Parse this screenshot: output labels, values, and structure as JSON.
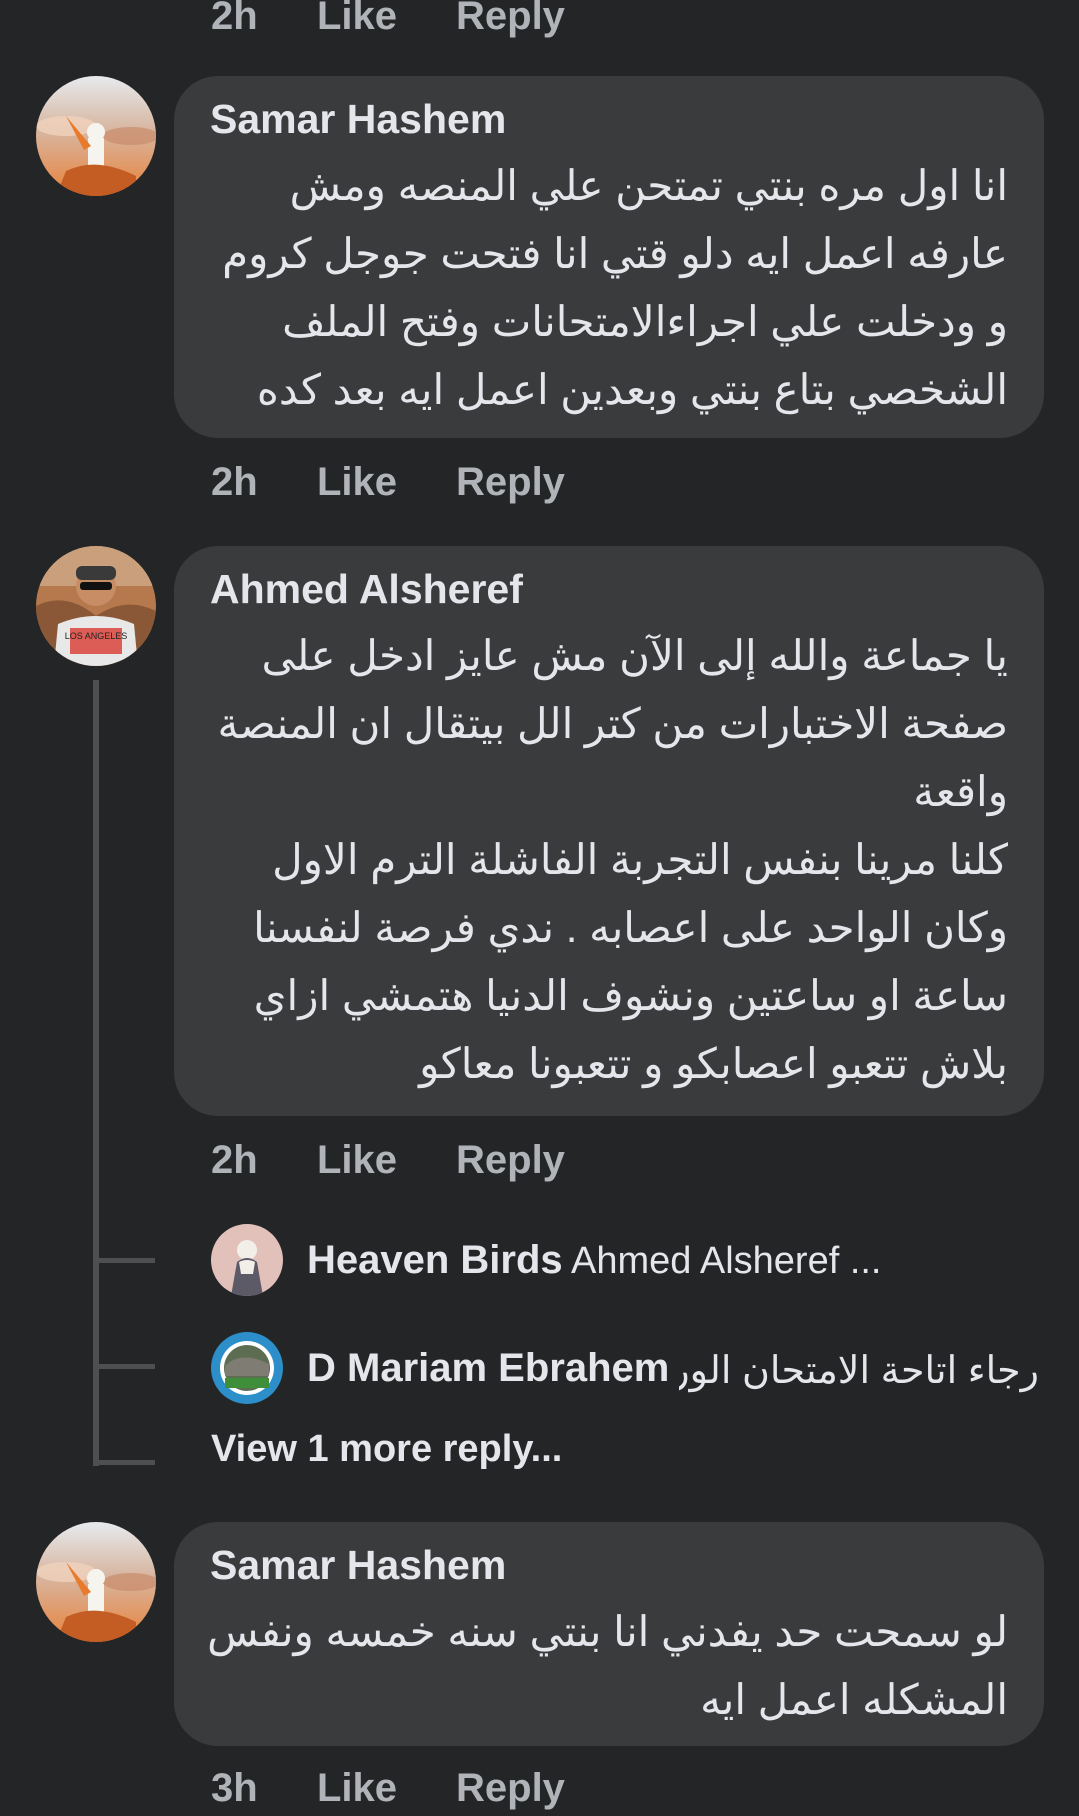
{
  "comments": [
    {
      "author": "",
      "time": "2h",
      "like": "Like",
      "reply": "Reply"
    },
    {
      "author": "Samar Hashem",
      "lines": [
        "انا اول مره بنتي تمتحن علي المنصه ومش",
        "عارفه اعمل ايه دلو قتي انا فتحت جوجل كروم",
        "و ودخلت علي اجراءالامتحانات وفتح الملف",
        "الشخصي بتاع بنتي وبعدين اعمل ايه بعد كده"
      ],
      "time": "2h",
      "like": "Like",
      "reply": "Reply"
    },
    {
      "author": "Ahmed Alsheref",
      "avatar_shirt_text": "LOS ANGELES",
      "lines": [
        "يا جماعة والله إلى الآن مش عايز ادخل على",
        "صفحة الاختبارات من كتر الل بيتقال ان المنصة",
        "واقعة",
        "كلنا مرينا بنفس التجربة الفاشلة الترم الاول",
        "وكان الواحد على اعصابه . ندي فرصة لنفسنا",
        "ساعة او ساعتين ونشوف الدنيا هتمشي ازاي",
        "بلاش تتعبو اعصابكو و تتعبونا معاكو"
      ],
      "time": "2h",
      "like": "Like",
      "reply": "Reply",
      "replies": [
        {
          "name": "Heaven Birds",
          "snippet": "Ahmed Alsheref ..."
        },
        {
          "name": "D Mariam Ebrahem",
          "snippet": "رجاء اتاحة الامتحان الور..."
        }
      ],
      "view_more": "View 1 more reply..."
    },
    {
      "author": "Samar Hashem",
      "lines": [
        "لو سمحت حد يفدني انا بنتي سنه خمسه ونفس",
        "المشكله اعمل ايه"
      ],
      "time": "3h",
      "like": "Like",
      "reply": "Reply"
    }
  ],
  "colors": {
    "background": "#242526",
    "bubble": "#3a3b3c",
    "primary_text": "#e4e6eb",
    "secondary_text": "#b0b3b8",
    "thread_line": "#4e4f50"
  },
  "icons": [
    "user-avatar-samar",
    "user-avatar-ahmed",
    "user-avatar-heaven-birds",
    "user-avatar-mariam"
  ]
}
